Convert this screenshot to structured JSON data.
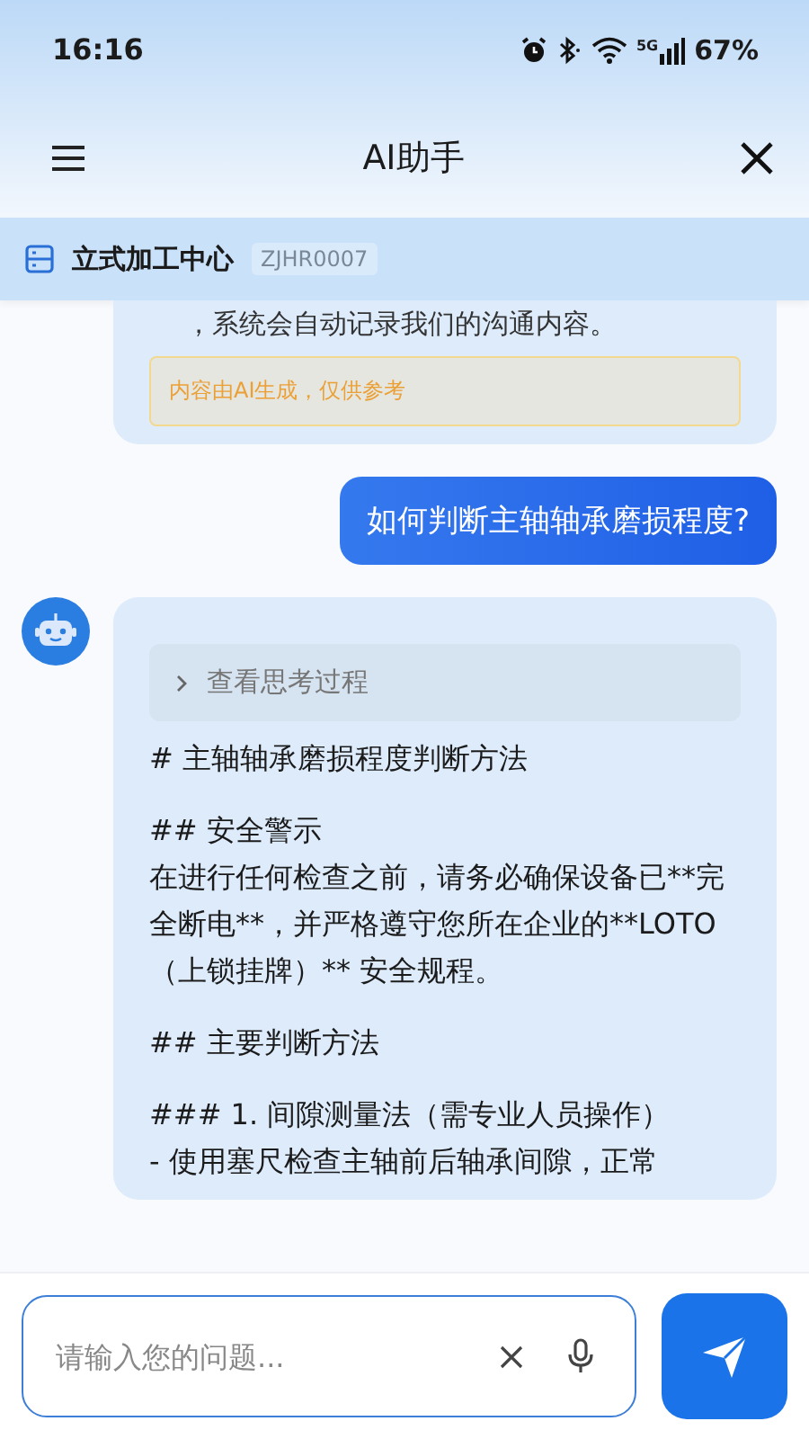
{
  "status_bar": {
    "time": "16:16",
    "network": "5G",
    "battery": "67%"
  },
  "header": {
    "title": "AI助手"
  },
  "device": {
    "name": "立式加工中心",
    "code": "ZJHR0007"
  },
  "messages": [
    {
      "kind": "assistant",
      "avatar": false,
      "text": "，系统会自动记录我们的沟通内容。",
      "notice": "内容由AI生成，仅供参考"
    },
    {
      "kind": "user",
      "text": "如何判断主轴轴承磨损程度?"
    },
    {
      "kind": "assistant",
      "avatar": true,
      "thinking": {
        "label": "查看思考过程",
        "expanded": false
      },
      "blocks": [
        [
          "# 主轴轴承磨损程度判断方法"
        ],
        [
          "## 安全警示",
          "在进行任何检查之前，请务必确保设备已**完全断电**，并严格遵守您所在企业的**LOTO（上锁挂牌）** 安全规程。"
        ],
        [
          "## 主要判断方法"
        ],
        [
          "### 1. 间隙测量法（需专业人员操作）",
          "- 使用塞尺检查主轴前后轴承间隙，正常"
        ]
      ]
    }
  ],
  "composer": {
    "placeholder": "请输入您的问题..."
  }
}
